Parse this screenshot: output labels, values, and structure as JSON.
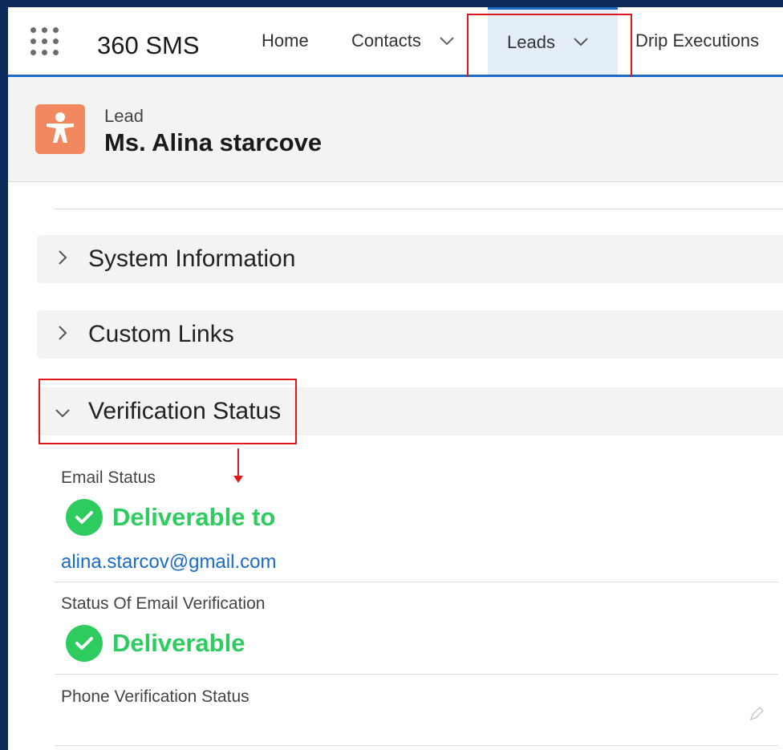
{
  "app": {
    "name": "360 SMS"
  },
  "nav": {
    "items": [
      {
        "label": "Home"
      },
      {
        "label": "Contacts"
      },
      {
        "label": "Leads"
      },
      {
        "label": "Drip Executions"
      }
    ],
    "active": "Leads"
  },
  "record": {
    "object_type": "Lead",
    "name": "Ms. Alina starcove"
  },
  "sections": [
    {
      "title": "System Information",
      "expanded": false
    },
    {
      "title": "Custom Links",
      "expanded": false
    },
    {
      "title": "Verification Status",
      "expanded": true
    }
  ],
  "fields": {
    "email_status": {
      "label": "Email Status",
      "status": "Deliverable to",
      "email": "alina.starcov@gmail.com"
    },
    "status_of_email_verification": {
      "label": "Status Of Email Verification",
      "status": "Deliverable"
    },
    "phone_verification_status": {
      "label": "Phone Verification Status",
      "value": ""
    }
  },
  "colors": {
    "accent": "#1b6ac9",
    "highlight": "#e0181b",
    "success": "#2ecc5f",
    "lead_icon": "#f28860"
  },
  "icons": [
    "app-launcher-icon",
    "chevron-down-icon",
    "lead-person-icon",
    "chevron-right-icon",
    "check-circle-icon",
    "pencil-icon"
  ]
}
